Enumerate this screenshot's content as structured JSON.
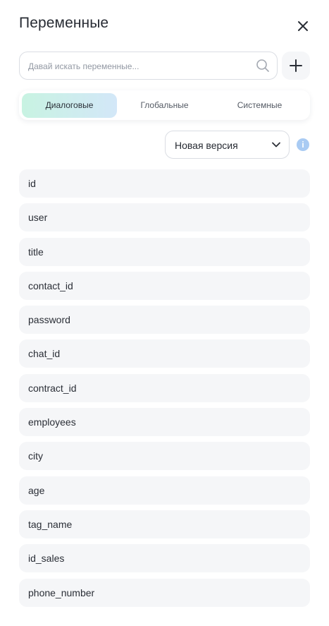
{
  "header": {
    "title": "Переменные"
  },
  "search": {
    "placeholder": "Давай искать переменные..."
  },
  "tabs": [
    {
      "label": "Диалоговые",
      "active": true
    },
    {
      "label": "Глобальные",
      "active": false
    },
    {
      "label": "Системные",
      "active": false
    }
  ],
  "version": {
    "selected": "Новая версия"
  },
  "variables": [
    "id",
    "user",
    "title",
    "contact_id",
    "password",
    "chat_id",
    "contract_id",
    "employees",
    "city",
    "age",
    "tag_name",
    "id_sales",
    "phone_number"
  ],
  "colors": {
    "active_tab_gradient_start": "#c8f3e2",
    "active_tab_gradient_end": "#d3e7f8",
    "item_background": "#f5f6f8",
    "info_icon": "#a9cbf3"
  },
  "icons": {
    "close": "close-icon",
    "search": "search-icon",
    "add": "plus-icon",
    "dropdown": "chevron-down-icon",
    "info": "info-icon"
  }
}
